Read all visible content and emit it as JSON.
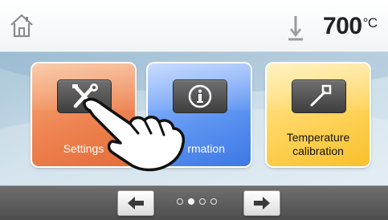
{
  "status": {
    "temperature": "700",
    "unit": "°C"
  },
  "tiles": [
    {
      "label": "Settings",
      "icon": "tools-icon",
      "color": "#ee8351"
    },
    {
      "label": "Information",
      "label_visible": "rmation",
      "icon": "info-icon",
      "color": "#5e95f2"
    },
    {
      "label_line1": "Temperature",
      "label_line2": "calibration",
      "icon": "calibration-pen-icon",
      "color": "#ffd35a"
    }
  ],
  "pager": {
    "pages": 4,
    "current": 2
  },
  "icons": {
    "home": "home-icon",
    "thermometer": "thermometer-icon",
    "prev": "arrow-left-icon",
    "next": "arrow-right-icon",
    "hand": "pointing-hand-icon"
  }
}
